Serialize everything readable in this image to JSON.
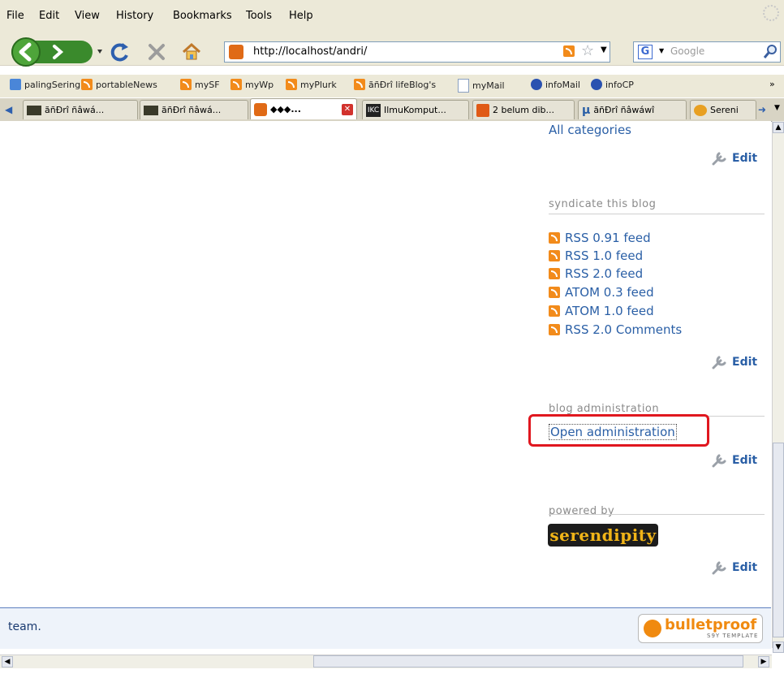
{
  "menu": [
    "File",
    "Edit",
    "View",
    "History",
    "Bookmarks",
    "Tools",
    "Help"
  ],
  "nav": {
    "url": "http://localhost/andri/",
    "search_placeholder": "Google"
  },
  "bookmarks": [
    "palingSering",
    "portableNews",
    "mySF",
    "myWp",
    "myPlurk",
    "ãñÐrî lifeBlog's",
    "myMail",
    "infoMail",
    "infoCP"
  ],
  "tabs": [
    "ãñÐrî ñâwá...",
    "ãñÐrî ñâwá...",
    "◆◆◆...",
    "IlmuKomput...",
    "2 belum dib...",
    "ãñÐrî ñâwáwî",
    "Sereni"
  ],
  "sidebar": {
    "all_categories": "All categories",
    "edit_label": "Edit",
    "syndicate_heading": "syndicate this blog",
    "feeds": [
      "RSS 0.91 feed",
      "RSS 1.0 feed",
      "RSS 2.0 feed",
      "ATOM 0.3 feed",
      "ATOM 1.0 feed",
      "RSS 2.0 Comments"
    ],
    "admin_heading": "blog administration",
    "open_admin": "Open administration",
    "powered_heading": "powered by",
    "powered_logo": "serendipity"
  },
  "footer": {
    "text": "team.",
    "badge_main": "bulletproof",
    "badge_sub": "S9Y TEMPLATE"
  },
  "colors": {
    "link": "#2a5fa6",
    "highlight": "#e0171f",
    "chrome": "#ece9d8",
    "rss": "#f28b1b"
  }
}
